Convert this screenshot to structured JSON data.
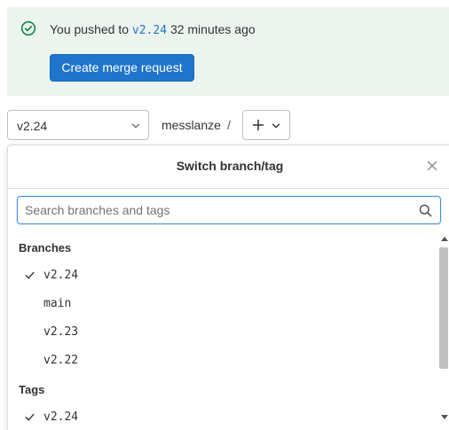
{
  "alert": {
    "prefix": "You pushed to",
    "branch": "v2.24",
    "suffix": "32 minutes ago",
    "button_label": "Create merge request",
    "icon": "check-circle-icon",
    "bg_color": "#ecf4ee",
    "accent_color": "#108548"
  },
  "toolbar": {
    "branch_value": "v2.24",
    "project": "messlanze",
    "separator": "/",
    "add_icon": "plus-icon"
  },
  "dropdown": {
    "title": "Switch branch/tag",
    "search_placeholder": "Search branches and tags",
    "branches_header": "Branches",
    "branches": [
      {
        "label": "v2.24",
        "selected": true
      },
      {
        "label": "main",
        "selected": false
      },
      {
        "label": "v2.23",
        "selected": false
      },
      {
        "label": "v2.22",
        "selected": false
      }
    ],
    "tags_header": "Tags",
    "tags": [
      {
        "label": "v2.24",
        "selected": true
      }
    ]
  },
  "colors": {
    "primary": "#1f75cb",
    "text": "#333238",
    "border": "#bfbfc3",
    "focus": "#428fdc"
  }
}
